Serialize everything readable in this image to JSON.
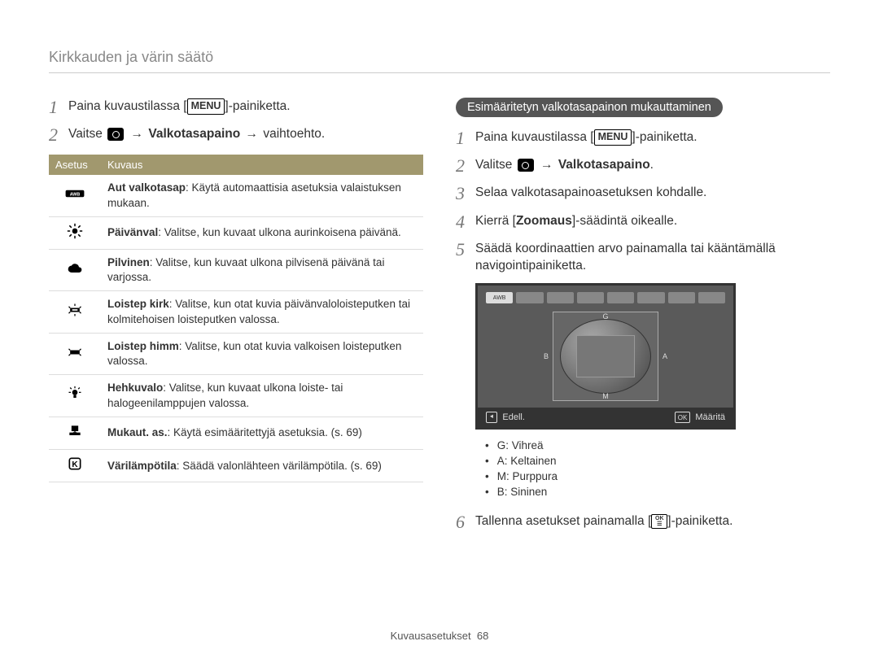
{
  "page_title": "Kirkkauden ja värin säätö",
  "footer": {
    "section": "Kuvausasetukset",
    "page": "68"
  },
  "left": {
    "steps": [
      {
        "num": "1",
        "pre": "Paina kuvaustilassa [",
        "chip": "MENU",
        "post": "]-painiketta."
      },
      {
        "num": "2",
        "pre": "Vaitse ",
        "cam": true,
        "arrow1": " → ",
        "bold1": "Valkotasapaino",
        "arrow2": " → ",
        "post": "vaihtoehto."
      }
    ],
    "table": {
      "head": {
        "col1": "Asetus",
        "col2": "Kuvaus"
      },
      "rows": [
        {
          "icon": "awb",
          "title": "Aut valkotasap",
          "desc": ": Käytä automaattisia asetuksia valaistuksen mukaan."
        },
        {
          "icon": "sun",
          "title": "Päivänval",
          "desc": ": Valitse, kun kuvaat ulkona aurinkoisena päivänä."
        },
        {
          "icon": "cloud",
          "title": "Pilvinen",
          "desc": ": Valitse, kun kuvaat ulkona pilvisenä päivänä tai varjossa."
        },
        {
          "icon": "fluor-w",
          "title": "Loistep kirk",
          "desc": ": Valitse, kun otat kuvia päivänvaloloisteputken tai kolmitehoisen loisteputken valossa."
        },
        {
          "icon": "fluor-n",
          "title": "Loistep himm",
          "desc": ": Valitse, kun otat kuvia valkoisen loisteputken valossa."
        },
        {
          "icon": "tungsten",
          "title": "Hehkuvalo",
          "desc": ": Valitse, kun kuvaat ulkona loiste- tai halogeenilamppujen valossa."
        },
        {
          "icon": "custom",
          "title": "Mukaut. as.",
          "desc": ": Käytä esimääritettyjä asetuksia. (s. 69)"
        },
        {
          "icon": "kelvin",
          "title": "Värilämpötila",
          "desc": ": Säädä valonlähteen värilämpötila. (s. 69)"
        }
      ]
    }
  },
  "right": {
    "heading": "Esimääritetyn valkotasapainon mukauttaminen",
    "steps": [
      {
        "num": "1",
        "pre": "Paina kuvaustilassa [",
        "chip": "MENU",
        "post": "]-painiketta."
      },
      {
        "num": "2",
        "pre": "Valitse ",
        "cam": true,
        "arrow1": " → ",
        "bold1": "Valkotasapaino",
        "post": "."
      },
      {
        "num": "3",
        "text": "Selaa valkotasapainoasetuksen kohdalle."
      },
      {
        "num": "4",
        "pre": "Kierrä [",
        "bold1": "Zoomaus",
        "post": "]-säädintä oikealle."
      },
      {
        "num": "5",
        "text": "Säädä koordinaattien arvo painamalla tai kääntämällä navigointipainiketta."
      }
    ],
    "screen": {
      "awb_label": "AWB",
      "axes": {
        "g": "G",
        "a": "A",
        "m": "M",
        "b": "B"
      },
      "back": "Edell.",
      "set": "Määritä"
    },
    "legend": [
      "G: Vihreä",
      "A: Keltainen",
      "M: Purppura",
      "B: Sininen"
    ],
    "step6": {
      "num": "6",
      "pre": "Tallenna asetukset painamalla [",
      "post": "]-painiketta."
    }
  }
}
